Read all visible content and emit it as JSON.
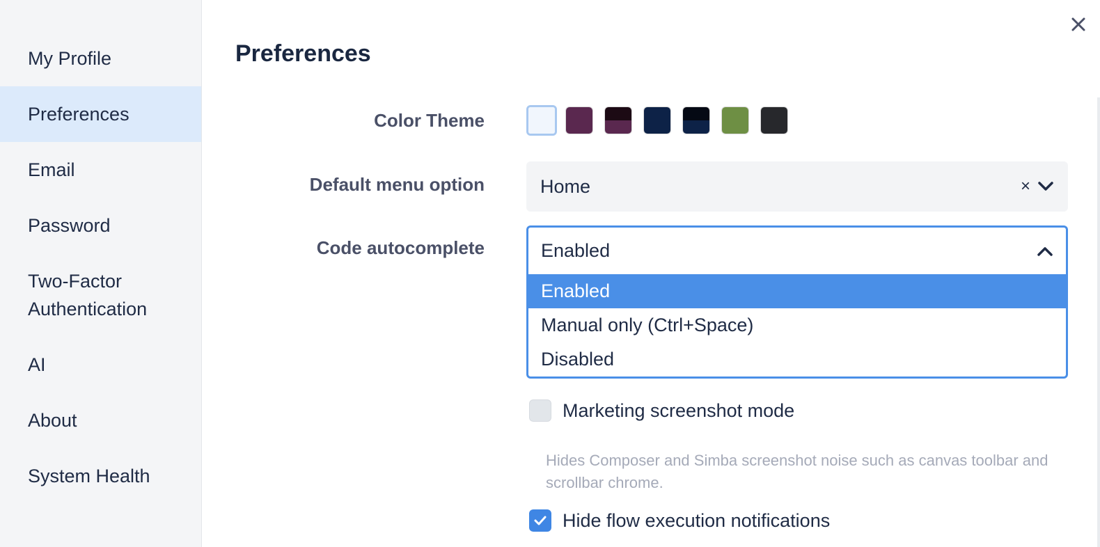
{
  "sidebar": {
    "items": [
      {
        "label": "My Profile"
      },
      {
        "label": "Preferences"
      },
      {
        "label": "Email"
      },
      {
        "label": "Password"
      },
      {
        "label": "Two-Factor Authentication"
      },
      {
        "label": "AI"
      },
      {
        "label": "About"
      },
      {
        "label": "System Health"
      }
    ],
    "active_index": 1
  },
  "main": {
    "title": "Preferences",
    "close_icon": "close-icon",
    "color_theme": {
      "label": "Color Theme",
      "swatches": [
        {
          "name": "light",
          "top": "#f1f6fd",
          "bottom": "#f1f6fd",
          "selected": true
        },
        {
          "name": "plum",
          "top": "#5a284f",
          "bottom": "#5a284f"
        },
        {
          "name": "plum-dark",
          "top": "#1c0a14",
          "bottom": "#5a284f"
        },
        {
          "name": "navy",
          "top": "#0d2247",
          "bottom": "#0d2247"
        },
        {
          "name": "navy-dark",
          "top": "#050914",
          "bottom": "#0d2247"
        },
        {
          "name": "olive",
          "top": "#6e8f44",
          "bottom": "#6e8f44"
        },
        {
          "name": "charcoal",
          "top": "#27282c",
          "bottom": "#27282c"
        }
      ]
    },
    "default_menu": {
      "label": "Default menu option",
      "value": "Home",
      "clear": "×"
    },
    "code_autocomplete": {
      "label": "Code autocomplete",
      "value": "Enabled",
      "options": [
        "Enabled",
        "Manual only (Ctrl+Space)",
        "Disabled"
      ],
      "selected_index": 0
    },
    "marketing_mode": {
      "label": "Marketing screenshot mode",
      "checked": false,
      "helper": "Hides Composer and Simba screenshot noise such as canvas toolbar and scrollbar chrome."
    },
    "hide_notifications": {
      "label": "Hide flow execution notifications",
      "checked": true
    }
  },
  "colors": {
    "accent": "#4a8fe7",
    "sidebar_active": "#dceafb",
    "sidebar_bg": "#f4f5f7"
  }
}
